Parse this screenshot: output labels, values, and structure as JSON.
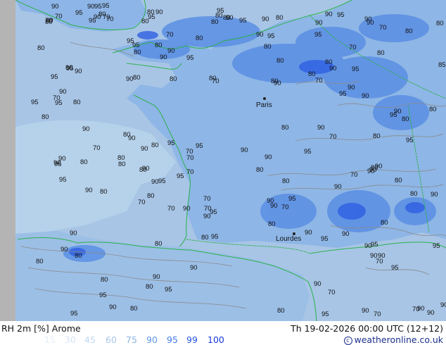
{
  "footer": {
    "title": "RH 2m [%] Arome",
    "valid": "Th 19-02-2026 00:00 UTC (12+12)",
    "credit": "© weatheronline.co.uk",
    "credit_icon": "copyright-icon"
  },
  "legend": [
    {
      "label": "15",
      "color": "#e6eef7"
    },
    {
      "label": "30",
      "color": "#d6e4f3"
    },
    {
      "label": "45",
      "color": "#c2d7ef"
    },
    {
      "label": "60",
      "color": "#a9c7ea"
    },
    {
      "label": "75",
      "color": "#88b2e5"
    },
    {
      "label": "90",
      "color": "#5f96e4"
    },
    {
      "label": "95",
      "color": "#3f7ce8"
    },
    {
      "label": "99",
      "color": "#2456e6"
    },
    {
      "label": "100",
      "color": "#1838d8"
    }
  ],
  "map": {
    "cities": [
      "Paris",
      "Lourdes"
    ],
    "contour_labels": [
      "90",
      "95",
      "90",
      "80",
      "90",
      "95",
      "95",
      "90",
      "95",
      "80",
      "90",
      "80",
      "95",
      "85",
      "90",
      "80",
      "95",
      "90",
      "90",
      "80",
      "95",
      "90",
      "95",
      "95",
      "90",
      "90",
      "90",
      "95",
      "95",
      "90",
      "90",
      "95",
      "95",
      "90",
      "95",
      "90",
      "95",
      "90",
      "80",
      "95",
      "95",
      "90",
      "90",
      "95",
      "90",
      "95",
      "90",
      "95",
      "95",
      "90",
      "80",
      "80",
      "95",
      "90",
      "80",
      "90",
      "90",
      "95",
      "90",
      "95",
      "95",
      "90",
      "90",
      "80",
      "95",
      "95",
      "80",
      "90",
      "95",
      "90",
      "95",
      "80",
      "70",
      "70",
      "80",
      "70",
      "80",
      "90",
      "70",
      "70",
      "80",
      "80",
      "90",
      "80",
      "90",
      "80",
      "95",
      "90",
      "95",
      "80",
      "90",
      "80",
      "90",
      "80",
      "70",
      "70",
      "80",
      "70",
      "80",
      "80",
      "70",
      "70",
      "80",
      "90",
      "95",
      "70",
      "90",
      "95",
      "90",
      "80",
      "95",
      "95",
      "90",
      "95",
      "90",
      "90",
      "90",
      "95",
      "95",
      "80",
      "70",
      "90",
      "95",
      "90",
      "80",
      "70",
      "80",
      "90",
      "80",
      "70",
      "80",
      "70",
      "80",
      "80",
      "90",
      "90",
      "80",
      "70",
      "90",
      "80",
      "70",
      "80",
      "80",
      "90",
      "80",
      "70",
      "80",
      "70",
      "90",
      "90",
      "80",
      "80",
      "80",
      "70",
      "80",
      "90",
      "80",
      "70",
      "80",
      "90",
      "70",
      "80",
      "80",
      "70",
      "80",
      "70",
      "80",
      "90",
      "80",
      "70",
      "80",
      "80",
      "80",
      "80",
      "90"
    ]
  }
}
